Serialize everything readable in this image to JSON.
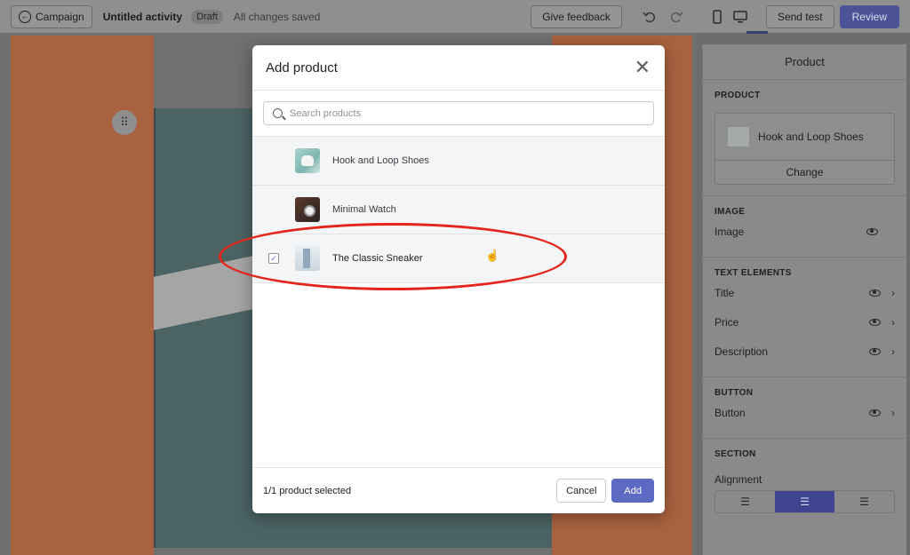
{
  "topbar": {
    "back_label": "Campaign",
    "title": "Untitled activity",
    "badge": "Draft",
    "saved_status": "All changes saved",
    "feedback_label": "Give feedback",
    "send_test_label": "Send test",
    "review_label": "Review",
    "icons": [
      "back-arrow-icon",
      "undo-icon",
      "redo-icon",
      "mobile-icon",
      "desktop-icon"
    ]
  },
  "modal": {
    "title": "Add product",
    "search_placeholder": "Search products",
    "products": [
      {
        "name": "Hook and Loop Shoes",
        "checked": false
      },
      {
        "name": "Minimal Watch",
        "checked": false
      },
      {
        "name": "The Classic Sneaker",
        "checked": true
      }
    ],
    "selected_count": "1/1 product selected",
    "cancel_label": "Cancel",
    "add_label": "Add"
  },
  "panel": {
    "header": "Product",
    "product_section": "PRODUCT",
    "product_name": "Hook and Loop Shoes",
    "change_label": "Change",
    "image_section": "IMAGE",
    "image_label": "Image",
    "text_section": "TEXT ELEMENTS",
    "text_rows": [
      "Title",
      "Price",
      "Description"
    ],
    "button_section": "BUTTON",
    "button_label": "Button",
    "section_section": "SECTION",
    "alignment_label": "Alignment",
    "alignment_selected": "center"
  },
  "colors": {
    "accent": "#5c6ac4",
    "annotation": "#e3251c",
    "canvas_orange": "#d9824f"
  }
}
